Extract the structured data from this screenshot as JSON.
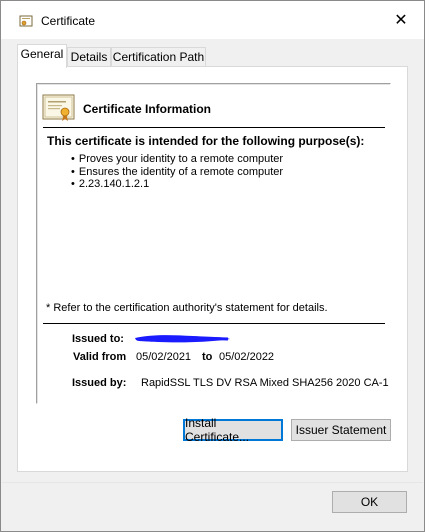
{
  "window": {
    "title": "Certificate",
    "close_glyph": "✕",
    "title_icon": "certificate-icon"
  },
  "tabs": [
    {
      "label": "General",
      "active": true
    },
    {
      "label": "Details",
      "active": false
    },
    {
      "label": "Certification Path",
      "active": false
    }
  ],
  "general": {
    "info_heading": "Certificate Information",
    "purpose_heading": "This certificate is intended for the following purpose(s):",
    "purposes": [
      "Proves your identity to a remote computer",
      "Ensures the identity of a remote computer",
      "2.23.140.1.2.1"
    ],
    "refer_note": "* Refer to the certification authority's statement for details.",
    "issued_to_label": "Issued to:",
    "issued_to_value": "",
    "issued_by_label": "Issued by:",
    "issued_by_value": "RapidSSL TLS DV RSA Mixed SHA256 2020 CA-1",
    "valid_from_label": "Valid from",
    "valid_from_value": "05/02/2021",
    "valid_to_label": "to",
    "valid_to_value": "05/02/2022"
  },
  "buttons": {
    "install": "Install Certificate...",
    "issuer_statement": "Issuer Statement",
    "ok": "OK"
  },
  "colors": {
    "redaction": "#1b1bff",
    "focus_border": "#0078d7"
  }
}
